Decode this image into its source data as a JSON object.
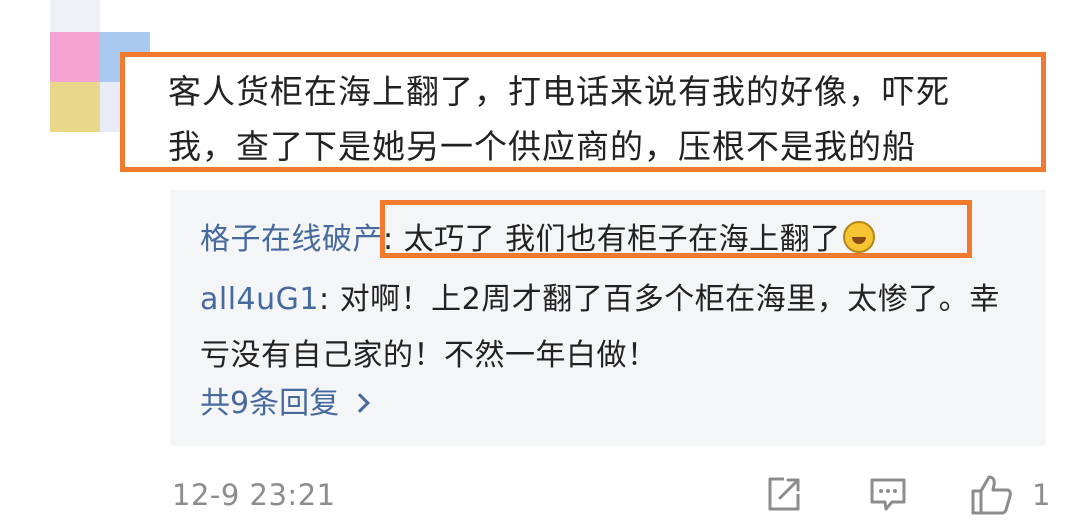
{
  "comment": {
    "line1": "客人货柜在海上翻了，打电话来说有我的好像，吓死",
    "line2": "我，查了下是她另一个供应商的，压根不是我的船"
  },
  "replies": [
    {
      "author": "格子在线破产",
      "text": ": 太巧了 我们也有柜子在海上翻了"
    },
    {
      "author": "all4uG1",
      "text": ": 对啊！上2周才翻了百多个柜在海里，太惨了。幸"
    },
    {
      "author": "",
      "text": "亏没有自己家的！不然一年白做！"
    }
  ],
  "more_replies_label": "共9条回复",
  "footer": {
    "timestamp": "12-9 23:21",
    "like_count": "1"
  },
  "colors": {
    "highlight": "#f27a2e",
    "link": "#46699e",
    "panel": "#f4f5f7"
  },
  "icons": [
    "share-icon",
    "comment-icon",
    "thumbs-up-icon",
    "chevron-right-icon",
    "laughing-emoji"
  ]
}
